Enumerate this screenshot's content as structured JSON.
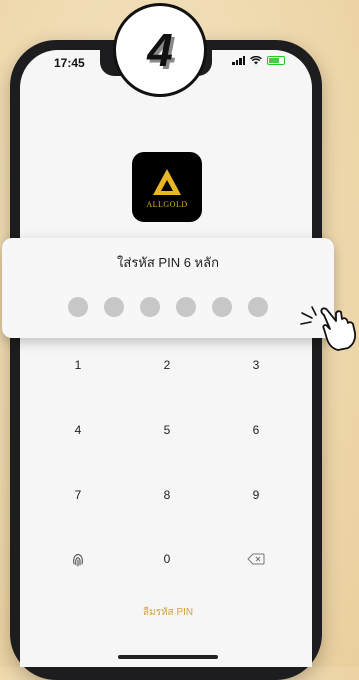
{
  "status_bar": {
    "time": "17:45"
  },
  "step_badge": {
    "number": "4"
  },
  "app_logo": {
    "brand": "ALLGOLD"
  },
  "pin_entry": {
    "title": "ใส่รหัส PIN 6 หลัก",
    "digits_entered": 0,
    "digits_total": 6
  },
  "keypad": {
    "keys": [
      "1",
      "2",
      "3",
      "4",
      "5",
      "6",
      "7",
      "8",
      "9",
      "0"
    ],
    "fingerprint_icon": "fingerprint-icon",
    "delete_icon": "backspace-icon"
  },
  "forgot_pin_label": "ลืมรหัส PIN",
  "colors": {
    "background": "#efd9ae",
    "accent": "#d5a23c",
    "logo_gold": "#e7b728",
    "dot_empty": "#c7c7c7"
  }
}
